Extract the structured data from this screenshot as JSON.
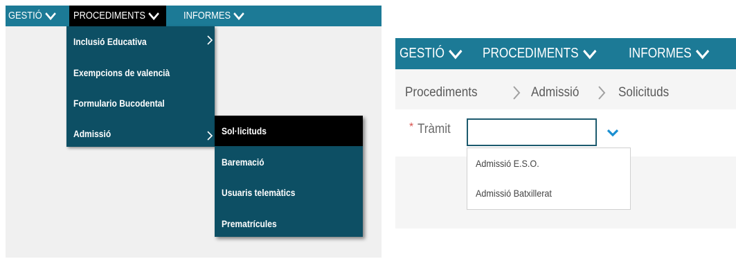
{
  "left": {
    "nav": {
      "gestio": "GESTIÓ",
      "procediments": "PROCEDIMENTS",
      "informes": "INFORMES"
    },
    "menu": [
      {
        "label": "Inclusió Educativa",
        "has_submenu": true
      },
      {
        "label": "Exempcions de valencià",
        "has_submenu": false
      },
      {
        "label": "Formulario Bucodental",
        "has_submenu": false
      },
      {
        "label": "Admissió",
        "has_submenu": true
      }
    ],
    "submenu": [
      {
        "label": "Sol·licituds",
        "highlighted": true
      },
      {
        "label": "Baremació"
      },
      {
        "label": "Usuaris telemàtics"
      },
      {
        "label": "Prematrícules"
      }
    ]
  },
  "right": {
    "nav": {
      "gestio": "GESTIÓ",
      "procediments": "PROCEDIMENTS",
      "informes": "INFORMES"
    },
    "breadcrumb": [
      "Procediments",
      "Admissió",
      "Solicituds"
    ],
    "form": {
      "required_mark": "*",
      "label": "Tràmit",
      "value": ""
    },
    "options": [
      "Admissió E.S.O.",
      "Admissió Batxillerat"
    ]
  },
  "colors": {
    "nav_bg": "#1c7a96",
    "menu_bg": "#0d4f64",
    "highlight": "#000000",
    "chevron_accent": "#1a8fd1",
    "required": "#d9534f"
  },
  "icons": [
    "chevron-down-icon",
    "chevron-right-icon",
    "breadcrumb-separator-icon"
  ]
}
